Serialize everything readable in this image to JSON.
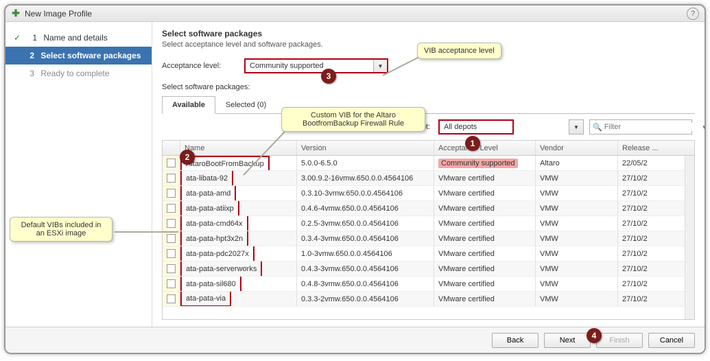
{
  "window_title": "New Image Profile",
  "steps": [
    {
      "num": "1",
      "label": "Name and details",
      "state": "completed"
    },
    {
      "num": "2",
      "label": "Select software packages",
      "state": "active"
    },
    {
      "num": "3",
      "label": "Ready to complete",
      "state": "disabled"
    }
  ],
  "main_title": "Select software packages",
  "main_subtitle": "Select acceptance level and software packages.",
  "acceptance_label": "Acceptance level:",
  "acceptance_value": "Community supported",
  "select_packages_label": "Select software packages:",
  "tabs": {
    "available": "Available",
    "selected": "Selected (0)"
  },
  "depot_label": "Software depot:",
  "depot_value": "All depots",
  "filter_placeholder": "Filter",
  "columns": {
    "name": "Name",
    "version": "Version",
    "acceptance": "Acceptance Level",
    "vendor": "Vendor",
    "release": "Release ..."
  },
  "rows": [
    {
      "name": "AltaroBootFromBackup",
      "version": "5.0.0-6.5.0",
      "acceptance": "Community supported",
      "vendor": "Altaro",
      "release": "22/05/2",
      "community": true
    },
    {
      "name": "ata-libata-92",
      "version": "3.00.9.2-16vmw.650.0.0.4564106",
      "acceptance": "VMware certified",
      "vendor": "VMW",
      "release": "27/10/2"
    },
    {
      "name": "ata-pata-amd",
      "version": "0.3.10-3vmw.650.0.0.4564106",
      "acceptance": "VMware certified",
      "vendor": "VMW",
      "release": "27/10/2"
    },
    {
      "name": "ata-pata-atiixp",
      "version": "0.4.6-4vmw.650.0.0.4564106",
      "acceptance": "VMware certified",
      "vendor": "VMW",
      "release": "27/10/2"
    },
    {
      "name": "ata-pata-cmd64x",
      "version": "0.2.5-3vmw.650.0.0.4564106",
      "acceptance": "VMware certified",
      "vendor": "VMW",
      "release": "27/10/2"
    },
    {
      "name": "ata-pata-hpt3x2n",
      "version": "0.3.4-3vmw.650.0.0.4564106",
      "acceptance": "VMware certified",
      "vendor": "VMW",
      "release": "27/10/2"
    },
    {
      "name": "ata-pata-pdc2027x",
      "version": "1.0-3vmw.650.0.0.4564106",
      "acceptance": "VMware certified",
      "vendor": "VMW",
      "release": "27/10/2"
    },
    {
      "name": "ata-pata-serverworks",
      "version": "0.4.3-3vmw.650.0.0.4564106",
      "acceptance": "VMware certified",
      "vendor": "VMW",
      "release": "27/10/2"
    },
    {
      "name": "ata-pata-sil680",
      "version": "0.4.8-3vmw.650.0.0.4564106",
      "acceptance": "VMware certified",
      "vendor": "VMW",
      "release": "27/10/2"
    },
    {
      "name": "ata-pata-via",
      "version": "0.3.3-2vmw.650.0.0.4564106",
      "acceptance": "VMware certified",
      "vendor": "VMW",
      "release": "27/10/2"
    }
  ],
  "buttons": {
    "back": "Back",
    "next": "Next",
    "finish": "Finish",
    "cancel": "Cancel"
  },
  "callouts": {
    "vib_level": "VIB acceptance level",
    "custom_vib": "Custom VIB for the Altaro BootfromBackup Firewall Rule",
    "default_vibs": "Default VIBs included in an ESXi image"
  },
  "badges": {
    "b1": "1",
    "b2": "2",
    "b3": "3",
    "b4": "4"
  }
}
